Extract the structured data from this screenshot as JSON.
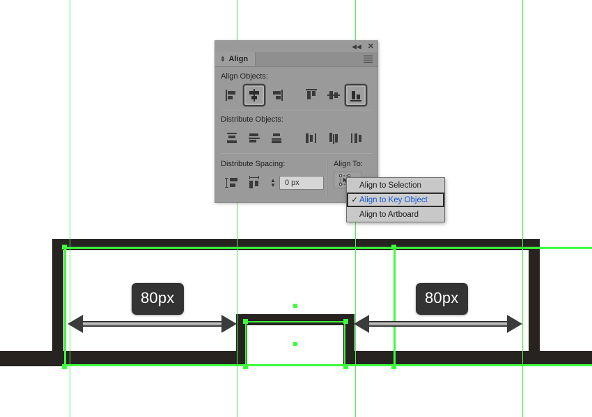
{
  "application": "illustrator-align-panel",
  "panel": {
    "tab_label": "Align",
    "tab_glyph": "⇕",
    "titlebar": {
      "collapse_icon": "◀◀",
      "close_icon": "✕"
    },
    "sections": {
      "align_objects": {
        "label": "Align Objects:",
        "buttons": [
          {
            "name": "horizontal-align-left",
            "active": false
          },
          {
            "name": "horizontal-align-center",
            "active": true
          },
          {
            "name": "horizontal-align-right",
            "active": false
          },
          {
            "name": "vertical-align-top",
            "active": false
          },
          {
            "name": "vertical-align-center",
            "active": false
          },
          {
            "name": "vertical-align-bottom",
            "active": true
          }
        ]
      },
      "distribute_objects": {
        "label": "Distribute Objects:",
        "buttons": [
          {
            "name": "vertical-distribute-top",
            "active": false
          },
          {
            "name": "vertical-distribute-center",
            "active": false
          },
          {
            "name": "vertical-distribute-bottom",
            "active": false
          },
          {
            "name": "horizontal-distribute-left",
            "active": false
          },
          {
            "name": "horizontal-distribute-center",
            "active": false
          },
          {
            "name": "horizontal-distribute-right",
            "active": false
          }
        ]
      },
      "distribute_spacing": {
        "label": "Distribute Spacing:",
        "buttons": [
          {
            "name": "vertical-distribute-spacing",
            "active": false
          },
          {
            "name": "horizontal-distribute-spacing",
            "active": false
          }
        ],
        "value": "0 px",
        "placeholder": "0 px"
      },
      "align_to": {
        "label": "Align To:",
        "selected": "Align to Key Object"
      }
    }
  },
  "dropdown": {
    "check_glyph": "✓",
    "items": [
      {
        "label": "Align to Selection",
        "selected": false
      },
      {
        "label": "Align to Key Object",
        "selected": true
      },
      {
        "label": "Align to Artboard",
        "selected": false
      }
    ]
  },
  "canvas": {
    "measurements": [
      {
        "label": "80px"
      },
      {
        "label": "80px"
      }
    ],
    "guides_x": [
      100,
      340,
      510,
      750
    ],
    "colors": {
      "guide_green": "#4ef24e",
      "selection_green": "#3dfc3d",
      "artwork_dark": "#272321",
      "badge_bg": "#333333",
      "panel_bg": "#9a9a9a",
      "menu_bg": "#c8c8c8",
      "highlight_blue": "#1558d6"
    }
  }
}
